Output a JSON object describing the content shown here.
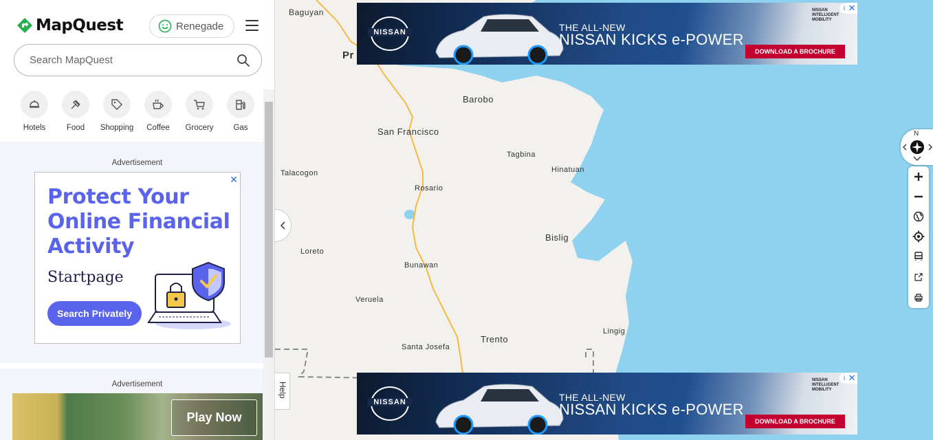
{
  "header": {
    "logo_text": "MapQuest",
    "user_name": "Renegade"
  },
  "search": {
    "placeholder": "Search MapQuest"
  },
  "categories": [
    {
      "label": "Hotels",
      "icon": "hotel-bell-icon"
    },
    {
      "label": "Food",
      "icon": "utensils-icon"
    },
    {
      "label": "Shopping",
      "icon": "tag-icon"
    },
    {
      "label": "Coffee",
      "icon": "coffee-cup-icon"
    },
    {
      "label": "Grocery",
      "icon": "cart-icon"
    },
    {
      "label": "Gas",
      "icon": "gas-pump-icon"
    }
  ],
  "ads": {
    "label_1": "Advertisement",
    "label_2": "Advertisement",
    "startpage": {
      "headline": "Protect Your Online Financial Activity",
      "brand": "Startpage",
      "cta": "Search Privately"
    },
    "game": {
      "cta": "Play Now"
    },
    "nissan": {
      "brand": "NISSAN",
      "line1": "THE ALL-NEW",
      "line2": "NISSAN KICKS e-POWER",
      "cta": "DOWNLOAD A BROCHURE",
      "corner_brand": "NISSAN INTELLIGENT MOBILITY"
    }
  },
  "map": {
    "help_label": "Help",
    "compass_label": "N",
    "places": {
      "baguyan": "Baguyan",
      "pr": "Pr",
      "barobo": "Barobo",
      "san_francisco": "San Francisco",
      "tagbina": "Tagbina",
      "hinatuan": "Hinatuan",
      "talacogon": "Talacogon",
      "rosario": "Rosario",
      "bislig": "Bislig",
      "loreto": "Loreto",
      "bunawan": "Bunawan",
      "veruela": "Veruela",
      "trento": "Trento",
      "lingig": "Lingig",
      "santa_josefa": "Santa Josefa"
    },
    "colors": {
      "water": "#8fd2f0",
      "land": "#f2f1ee",
      "road": "#f5b944"
    }
  },
  "colors": {
    "brand_green": "#22b24c",
    "startpage_purple": "#5a63ec",
    "nissan_red": "#c3002f"
  }
}
